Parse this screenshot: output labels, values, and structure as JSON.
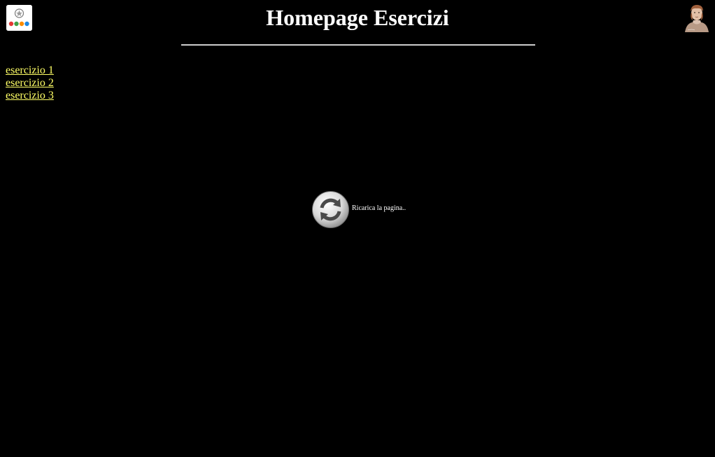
{
  "header": {
    "title": "Homepage Esercizi"
  },
  "nav": {
    "links": [
      {
        "label": "esercizio 1"
      },
      {
        "label": "esercizio 2"
      },
      {
        "label": "esercizio 3"
      }
    ]
  },
  "reload": {
    "label": "Ricarica la pagina..",
    "icon": "refresh-icon"
  },
  "logos": {
    "left": "school-emblem-logo",
    "right": "portrait-bust-logo"
  },
  "colors": {
    "background": "#000000",
    "title": "#ffffff",
    "link": "#ffff66"
  }
}
